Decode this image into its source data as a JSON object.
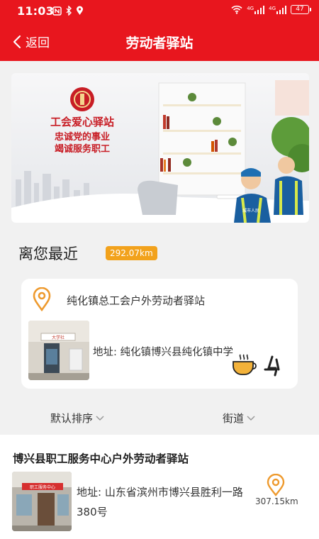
{
  "status_bar": {
    "time": "11:03",
    "network_1": "4G",
    "network_2": "4G",
    "battery": "47"
  },
  "header": {
    "back_label": "返回",
    "title": "劳动者驿站"
  },
  "banner": {
    "sign_title": "工会爱心驿站",
    "sign_line1": "忠诚党的事业",
    "sign_line2": "竭诚服务职工",
    "vest_text": "城市人民"
  },
  "nearest": {
    "heading": "离您最近",
    "distance": "292.07km",
    "station_name": "纯化镇总工会户外劳动者驿站",
    "address": "地址: 纯化镇博兴县纯化镇中学",
    "photo_sign": "大学社"
  },
  "filters": {
    "sort_label": "默认排序",
    "street_label": "街道"
  },
  "list": [
    {
      "name": "博兴县职工服务中心户外劳动者驿站",
      "address": "地址: 山东省滨州市博兴县胜利一路380号",
      "distance": "307.15km",
      "photo_sign": "职工服务中心"
    }
  ],
  "colors": {
    "header_red": "#e8161e",
    "accent_orange": "#f2a21c",
    "icon_orange": "#ee9a2e"
  }
}
